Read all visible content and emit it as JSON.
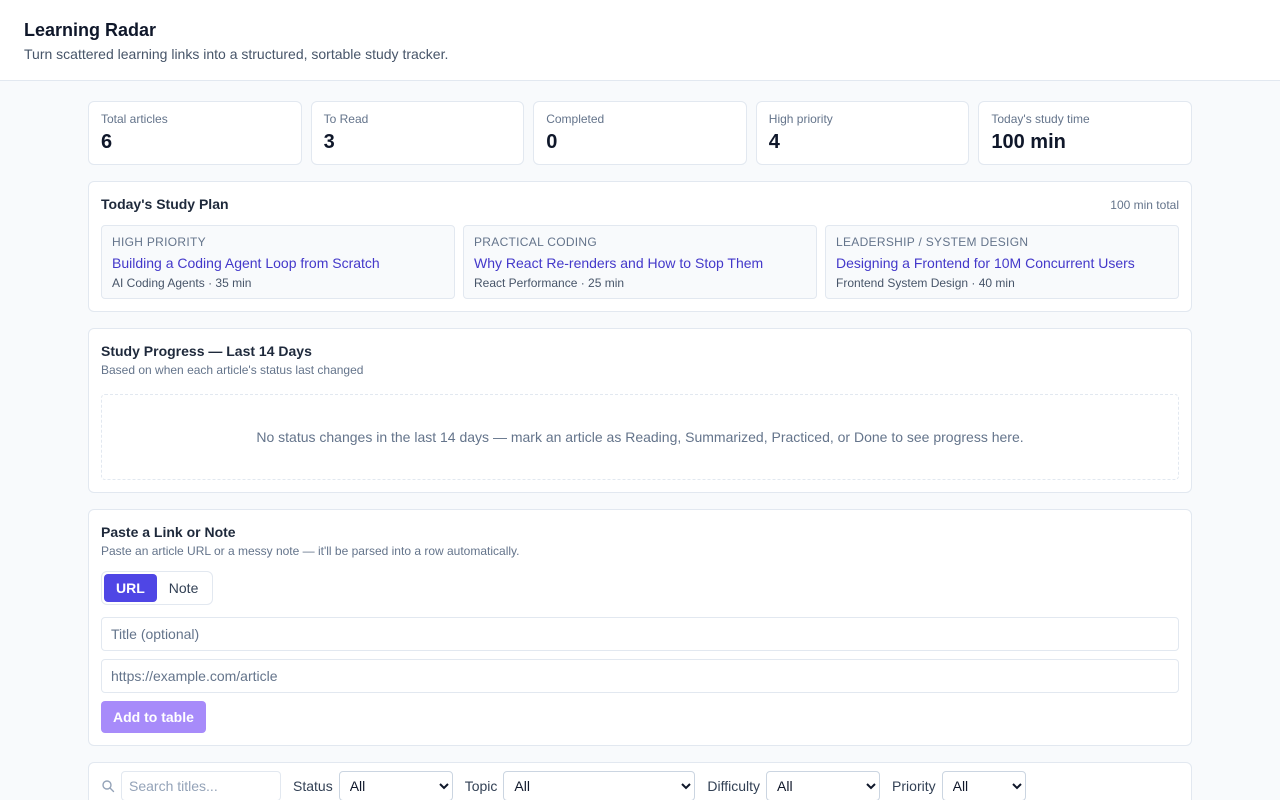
{
  "header": {
    "title": "Learning Radar",
    "subtitle": "Turn scattered learning links into a structured, sortable study tracker."
  },
  "stats": [
    {
      "label": "Total articles",
      "value": "6"
    },
    {
      "label": "To Read",
      "value": "3"
    },
    {
      "label": "Completed",
      "value": "0"
    },
    {
      "label": "High priority",
      "value": "4"
    },
    {
      "label": "Today's study time",
      "value": "100 min"
    }
  ],
  "plan": {
    "title": "Today's Study Plan",
    "total": "100 min total",
    "items": [
      {
        "category": "HIGH PRIORITY",
        "title": "Building a Coding Agent Loop from Scratch",
        "meta": "AI Coding Agents · 35 min"
      },
      {
        "category": "PRACTICAL CODING",
        "title": "Why React Re-renders and How to Stop Them",
        "meta": "React Performance · 25 min"
      },
      {
        "category": "LEADERSHIP / SYSTEM DESIGN",
        "title": "Designing a Frontend for 10M Concurrent Users",
        "meta": "Frontend System Design · 40 min"
      }
    ]
  },
  "progress": {
    "title": "Study Progress — Last 14 Days",
    "subtitle": "Based on when each article's status last changed",
    "empty": "No status changes in the last 14 days — mark an article as Reading, Summarized, Practiced, or Done to see progress here."
  },
  "paste": {
    "title": "Paste a Link or Note",
    "subtitle": "Paste an article URL or a messy note — it'll be parsed into a row automatically.",
    "tabs": [
      "URL",
      "Note"
    ],
    "title_placeholder": "Title (optional)",
    "url_placeholder": "https://example.com/article",
    "add_label": "Add to table"
  },
  "filters": {
    "search_placeholder": "Search titles...",
    "status_label": "Status",
    "status_value": "All",
    "topic_label": "Topic",
    "topic_value": "All",
    "difficulty_label": "Difficulty",
    "difficulty_value": "All",
    "priority_label": "Priority",
    "priority_value": "All"
  },
  "colors": {
    "accent": "#4f46e5",
    "link": "#4338ca",
    "button_disabled": "#a78bfa"
  }
}
